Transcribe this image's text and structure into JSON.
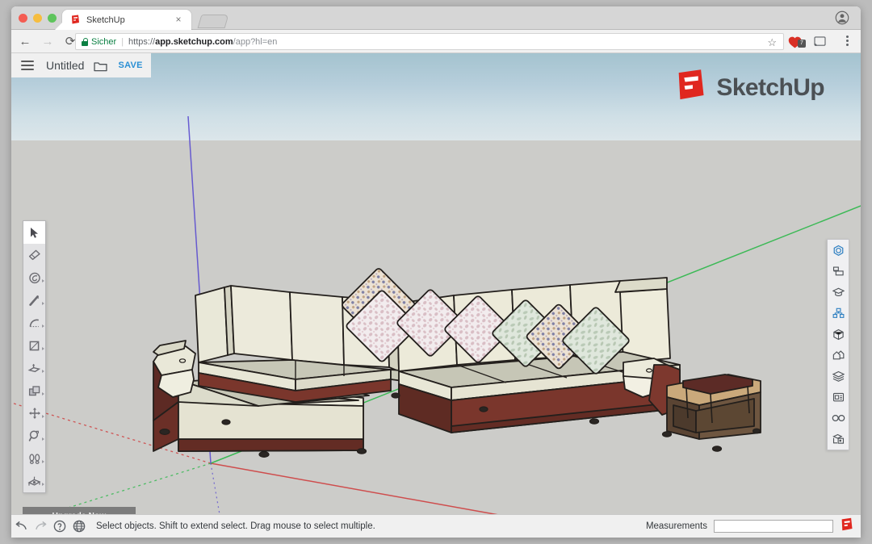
{
  "browser": {
    "window_controls": [
      "close",
      "minimize",
      "zoom"
    ],
    "tab": {
      "title": "SketchUp",
      "favicon": "sketchup-favicon",
      "close_label": "×"
    },
    "new_tab_label": "new-tab",
    "profile_icon": "account-circle-icon",
    "nav": {
      "back": "←",
      "forward": "→",
      "reload": "⟳"
    },
    "url": {
      "security_label": "Sicher",
      "scheme": "https://",
      "host": "app.sketchup.com",
      "path": "/app?hl=en"
    },
    "star_icon": "☆",
    "extension_badge_count": "7",
    "cast_icon": "cast-icon",
    "menu_icon": "kebab-menu-icon"
  },
  "appbar": {
    "menu_icon": "hamburger-menu-icon",
    "document_title": "Untitled",
    "folder_icon": "folder-icon",
    "save_label": "SAVE"
  },
  "watermark": {
    "logo_icon": "sketchup-logo-icon",
    "text": "SketchUp"
  },
  "toolbar": {
    "tools": [
      {
        "name": "select-tool",
        "icon": "cursor-arrow-icon",
        "active": true,
        "flyout": false
      },
      {
        "name": "eraser-tool",
        "icon": "eraser-icon",
        "active": false,
        "flyout": false
      },
      {
        "name": "paint-tool",
        "icon": "paint-bucket-icon",
        "active": false,
        "flyout": true
      },
      {
        "name": "line-tool",
        "icon": "pencil-icon",
        "active": false,
        "flyout": true
      },
      {
        "name": "arc-tool",
        "icon": "arc-icon",
        "active": false,
        "flyout": true
      },
      {
        "name": "rectangle-tool",
        "icon": "rectangle-icon",
        "active": false,
        "flyout": true
      },
      {
        "name": "pushpull-tool",
        "icon": "push-pull-icon",
        "active": false,
        "flyout": true
      },
      {
        "name": "offset-tool",
        "icon": "offset-icon",
        "active": false,
        "flyout": true
      },
      {
        "name": "move-tool",
        "icon": "move-arrows-icon",
        "active": false,
        "flyout": true
      },
      {
        "name": "zoom-tool",
        "icon": "magnifier-icon",
        "active": false,
        "flyout": true
      },
      {
        "name": "walk-tool",
        "icon": "footprints-icon",
        "active": false,
        "flyout": true
      },
      {
        "name": "section-tool",
        "icon": "section-plane-icon",
        "active": false,
        "flyout": true
      }
    ]
  },
  "tray": {
    "items": [
      {
        "name": "tray-item-3d-warehouse",
        "icon": "cube-outline-icon",
        "active": true
      },
      {
        "name": "tray-item-entity-info",
        "icon": "entity-info-icon",
        "active": false
      },
      {
        "name": "tray-item-instructor",
        "icon": "graduation-cap-icon",
        "active": false
      },
      {
        "name": "tray-item-components",
        "icon": "components-icon",
        "active": true
      },
      {
        "name": "tray-item-materials",
        "icon": "materials-cube-icon",
        "active": false
      },
      {
        "name": "tray-item-styles",
        "icon": "styles-house-icon",
        "active": false
      },
      {
        "name": "tray-item-layers",
        "icon": "layers-stack-icon",
        "active": false
      },
      {
        "name": "tray-item-scenes",
        "icon": "scenes-icon",
        "active": false
      },
      {
        "name": "tray-item-soften-edges",
        "icon": "infinity-icon",
        "active": false
      },
      {
        "name": "tray-item-settings",
        "icon": "model-settings-icon",
        "active": false
      }
    ]
  },
  "upgrade": {
    "label": "Upgrade Now"
  },
  "status": {
    "undo_icon": "undo-arrow-icon",
    "redo_icon": "redo-arrow-icon",
    "help_icon": "help-circle-icon",
    "globe_icon": "globe-icon",
    "message": "Select objects. Shift to extend select. Drag mouse to select multiple.",
    "measurements_label": "Measurements",
    "measurements_value": "",
    "measurements_placeholder": "",
    "logo_icon": "sketchup-logo-icon"
  },
  "viewport": {
    "model_name": "sectional-sofa-with-side-table",
    "sky_top_color": "#a4c3cf",
    "sky_bottom_color": "#dce6ea",
    "ground_color": "#ccccc9",
    "axes": {
      "origin": [
        247,
        508
      ],
      "red_color": "#cf4040",
      "green_color": "#2db84a",
      "blue_color": "#5c4ed0"
    },
    "materials": {
      "cushion_color": "#e8e7d6",
      "seat_top_color": "#c6c6b6",
      "frame_color": "#76342c",
      "edge_color": "#231f1c",
      "table_top_color": "#5c2b26",
      "table_base_color": "#caa97b"
    },
    "pillow_count": 7
  }
}
